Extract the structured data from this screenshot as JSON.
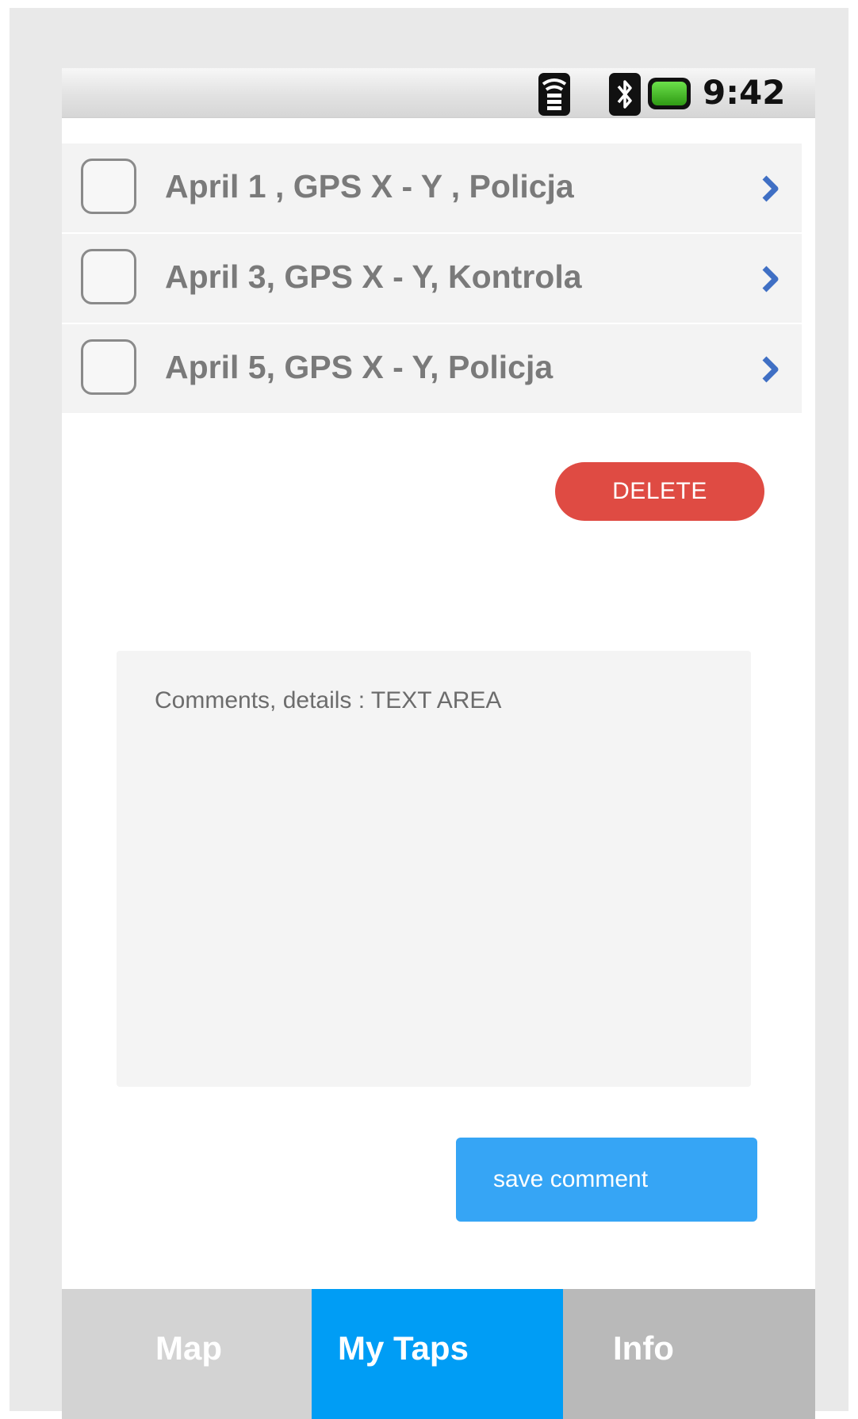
{
  "status_bar": {
    "time": "9:42",
    "icons": [
      "wifi-icon",
      "bluetooth-icon",
      "battery-icon"
    ],
    "battery_color": "#3fb51e"
  },
  "list": {
    "items": [
      {
        "label": "April 1 , GPS X - Y , Policja",
        "checked": false
      },
      {
        "label": "April 3, GPS X - Y, Kontrola",
        "checked": false
      },
      {
        "label": "April 5, GPS X - Y, Policja",
        "checked": false
      }
    ],
    "chevron_color": "#3f6fc4"
  },
  "actions": {
    "delete_label": "DELETE",
    "delete_color": "#df4b43"
  },
  "comments": {
    "placeholder": "Comments, details : TEXT AREA"
  },
  "save": {
    "label": "save comment",
    "color": "#36a5f5"
  },
  "tabs": [
    {
      "label": "Map",
      "active": false
    },
    {
      "label": "My Taps",
      "active": true
    },
    {
      "label": "Info",
      "active": false
    }
  ],
  "colors": {
    "active_tab": "#009df5",
    "inactive_tab": "#d3d3d3"
  }
}
